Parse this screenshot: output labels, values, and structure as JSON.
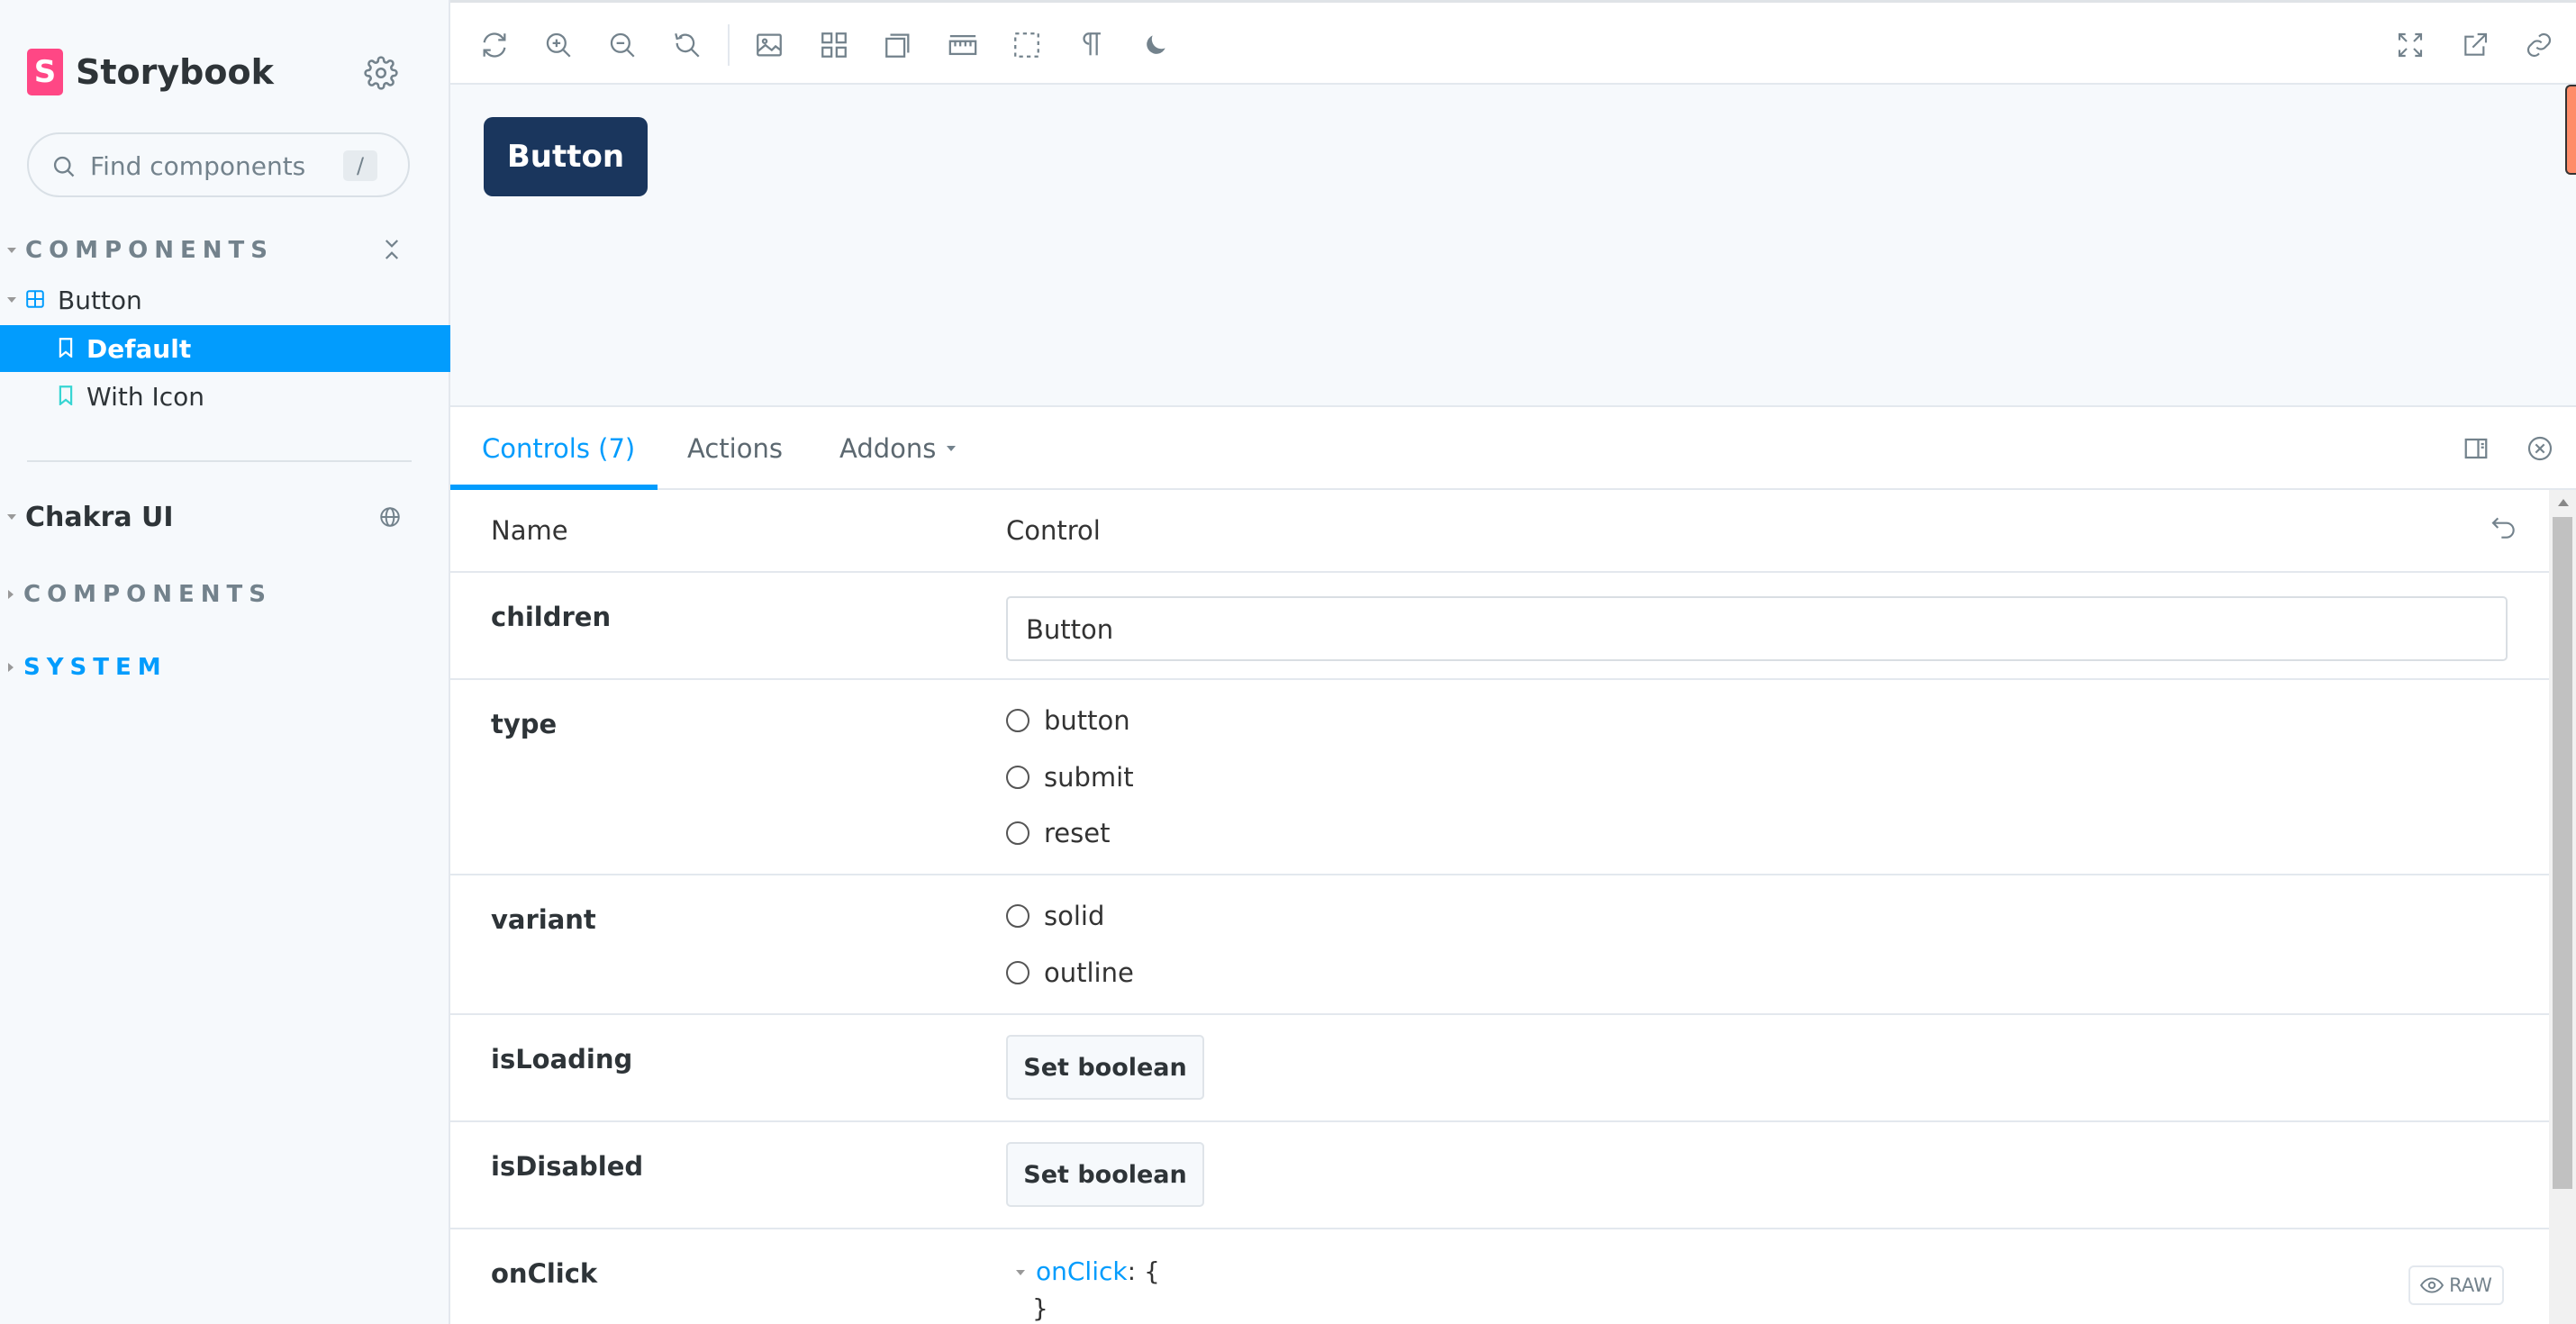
{
  "sidebar": {
    "brand": {
      "mark": "S",
      "name": "Storybook"
    },
    "search": {
      "placeholder": "Find components",
      "shortcut": "/"
    },
    "components_heading": "COMPONENTS",
    "tree": [
      {
        "label": "Button",
        "kind": "component",
        "expanded": true
      },
      {
        "label": "Default",
        "kind": "story",
        "selected": true
      },
      {
        "label": "With Icon",
        "kind": "story",
        "selected": false
      }
    ],
    "ref": {
      "title": "Chakra UI"
    },
    "ref_sections": [
      {
        "label": "COMPONENTS",
        "expanded": false
      },
      {
        "label": "SYSTEM",
        "expanded": false
      }
    ]
  },
  "toolbar": {
    "left_tools": [
      "remount-icon",
      "zoom-in-icon",
      "zoom-out-icon",
      "zoom-reset-icon",
      "background-icon",
      "grid-icon",
      "viewport-icon",
      "measure-icon",
      "outline-icon",
      "text-direction-icon",
      "dark-mode-icon"
    ],
    "right_tools": [
      "fullscreen-icon",
      "open-new-tab-icon",
      "copy-link-icon"
    ]
  },
  "canvas": {
    "preview_button_label": "Button"
  },
  "addons": {
    "tabs": [
      {
        "label": "Controls (7)",
        "active": true
      },
      {
        "label": "Actions",
        "active": false
      },
      {
        "label": "Addons",
        "active": false,
        "dropdown": true
      }
    ],
    "table": {
      "header": {
        "name": "Name",
        "control": "Control"
      },
      "rows": {
        "children": {
          "name": "children",
          "value": "Button"
        },
        "type": {
          "name": "type",
          "options": [
            "button",
            "submit",
            "reset"
          ]
        },
        "variant": {
          "name": "variant",
          "options": [
            "solid",
            "outline"
          ]
        },
        "isLoading": {
          "name": "isLoading",
          "button": "Set boolean"
        },
        "isDisabled": {
          "name": "isDisabled",
          "button": "Set boolean"
        },
        "onClick": {
          "name": "onClick",
          "json_key": "onClick",
          "json_open": ": {",
          "json_close": "}",
          "raw_label": "RAW"
        }
      }
    }
  },
  "colors": {
    "accent": "#029cfd",
    "brand": "#ff4785",
    "preview_button": "#1a365d"
  }
}
